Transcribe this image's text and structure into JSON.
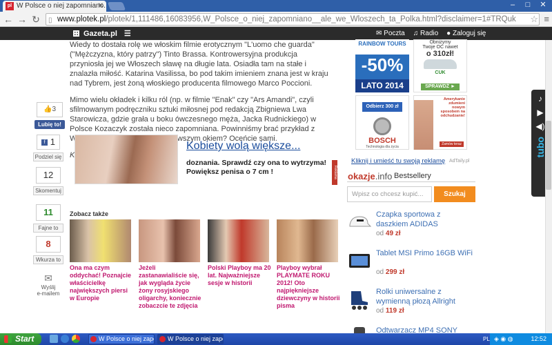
{
  "browser": {
    "tab_title": "W Polsce o niej zapomniano...",
    "favicon_text": "pl",
    "url_host": "www.plotek.pl",
    "url_path": "/plotek/1,111486,16083956,W_Polsce_o_niej_zapomniano__ale_we_Wloszech_ta_Polka.html?disclaimer=1#TRQuk"
  },
  "sitebar": {
    "brand": "Gazeta.pl",
    "links": [
      "Poczta",
      "Radio",
      "Zaloguj się"
    ]
  },
  "article": {
    "paragraphs": [
      "Wiedy to dostała rolę we włoskim filmie erotycznym \"L'uomo che guarda\" (\"Mężczyzna, który patrzy\") Tinto Brassa. Kontrowersyjna produkcja przyniosła jej we Włoszech sławę na długie lata. Osiadła tam na stałe i znalazła miłość. Katarina Vasilissa, bo pod takim imieniem znana jest w kraju nad Tybrem, jest żoną włoskiego producenta filmowego Marco Poccioni.",
      "Mimo wielu okładek i kilku ról (np. w filmie \"Enak\" czy \"Ars Amandi\", czyli sfilmowanym podręczniku sztuki miłosnej pod redakcją Zbigniewa Lwa Starowicza, gdzie grała u boku ówczesnego męża, Jacka Rudnickiego) w Polsce Kozaczyk została nieco zapomniana. Powinniśmy brać przykład z Włochów i spojrzeć na nią łaskawszym okiem? Oceńcie sami.",
      "Karo"
    ]
  },
  "social": {
    "like_count": "3",
    "like_button": "Lubię to!",
    "share_count": "1",
    "share_label": "Podziel się",
    "comments_count": "12",
    "comments_label": "Skomentuj",
    "fajne_count": "11",
    "fajne_label": "Fajne to",
    "wkurza_count": "8",
    "wkurza_label": "Wkurza to",
    "email_label_1": "Wyślij",
    "email_label_2": "e-mailem"
  },
  "ad": {
    "title": "Kobiety wolą większe...",
    "line1": "doznania. Sprawdź czy ona to wytrzyma!",
    "line2": "Powiększ penisa o 7 cm !",
    "badge": "Reklama"
  },
  "zobacz": {
    "heading": "Zobacz także",
    "items": [
      {
        "caption": "Ona ma czym oddychać! Poznajcie właścicielkę największych piersi w Europie"
      },
      {
        "caption": "Jeżeli zastanawialiście się, jak wygląda życie żony rosyjskiego oligarchy, koniecznie zobaczcie te zdjęcia"
      },
      {
        "caption": "Polski Playboy ma 20 lat. Najważniejsze sesje w historii"
      },
      {
        "caption": "Playboy wybrał PLAYMATE ROKU 2012! Oto najpiękniejsze dziewczyny w historii pisma"
      }
    ]
  },
  "right_ads": {
    "rainbow_brand": "RAINBOW TOURS",
    "rainbow_pct": "-50%",
    "rainbow_lato": "LATO 2014",
    "cuk_line1": "Obniżymy",
    "cuk_line2": "Twoje OC nawet",
    "cuk_line3": "o 310zł!",
    "cuk_brand": "CUK",
    "cuk_button": "SPRAWDŹ ►",
    "bosch_button": "Odbierz 300 zł",
    "bosch_logo": "BOSCH",
    "bosch_sub": "Technologia dla życia",
    "amer_text": "Amerykanie zdumieni nowym sposobem na odchudzanie!",
    "amer_button": "Zamów teraz",
    "kliknij": "Kliknij i umieść tu swoją reklamę",
    "adtaily": "AdTaily.pl"
  },
  "okazje": {
    "logo_a": "okazje",
    "logo_b": ".info",
    "tab": "Bestsellery",
    "search_placeholder": "Wpisz co chcesz kupić...",
    "search_button": "Szukaj",
    "products": [
      {
        "name": "Czapka sportowa z daszkiem ADIDAS",
        "price": "49 zł"
      },
      {
        "name": "Tablet MSI Primo 16GB WiFi",
        "price": "299 zł"
      },
      {
        "name": "Rolki uniwersalne z wymienną płozą Allright",
        "price": "119 zł"
      },
      {
        "name": "Odtwarzacz MP4 SONY"
      }
    ],
    "price_prefix": "od"
  },
  "taskbar": {
    "start": "Start",
    "tasks": [
      "W Polsce o niej zapo...",
      "W Polsce o niej zapo..."
    ],
    "lang": "PL",
    "time": "12:52"
  },
  "colors": {
    "link_blue": "#1a4c9c",
    "caption_magenta": "#c0186f",
    "okazje_red": "#c0392b",
    "szukaj_orange": "#f28c1f",
    "site_bar": "#2b2b2b"
  }
}
